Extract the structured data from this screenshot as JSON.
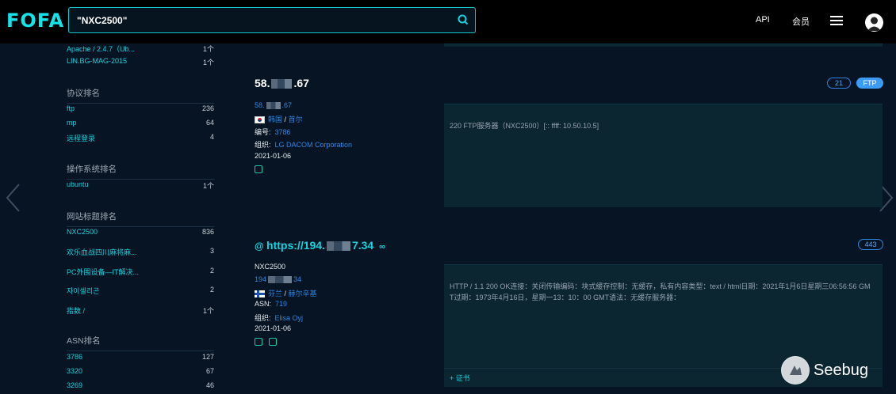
{
  "header": {
    "logo": "FOFA",
    "search_value": "\"NXC2500\"",
    "nav_api": "API",
    "nav_vip": "会员"
  },
  "sidebar": {
    "top_items": [
      {
        "label": "Apache / 2.4.7（Ub...",
        "count": "1个"
      },
      {
        "label": "LIN.BG-MAG-2015",
        "count": "1个"
      }
    ],
    "protocol": {
      "title": "协议排名",
      "items": [
        {
          "label": "ftp",
          "count": "236"
        },
        {
          "label": "mp",
          "count": "64"
        },
        {
          "label": "远程登录",
          "count": "4"
        }
      ]
    },
    "os": {
      "title": "操作系统排名",
      "items": [
        {
          "label": "ubuntu",
          "count": "1个"
        }
      ]
    },
    "site_title": {
      "title": "网站标题排名",
      "items": [
        {
          "label": "NXC2500",
          "count": "836"
        },
        {
          "label": "欢乐血战四川麻将麻...",
          "count": "3"
        },
        {
          "label": "PC外围设备—IT解决...",
          "count": "2"
        },
        {
          "label": "자이셀리곤",
          "count": "2"
        },
        {
          "label": "指数 /",
          "count": "1个"
        }
      ]
    },
    "asn": {
      "title": "ASN排名",
      "items": [
        {
          "label": "3786",
          "count": "127"
        },
        {
          "label": "3320",
          "count": "67"
        },
        {
          "label": "3269",
          "count": "46"
        }
      ]
    }
  },
  "results": [
    {
      "title_prefix": "58.",
      "title_suffix": ".67",
      "ip_prefix": "58.",
      "ip_suffix": ".67",
      "country": "韩国",
      "city": "首尔",
      "number_label": "编号:",
      "number_value": "3786",
      "org_label": "组织:",
      "org_value": "LG DACOM Corporation",
      "date": "2021-01-06",
      "port": "21",
      "protocol": "FTP",
      "banner": "220 FTP服务器（NXC2500）[:: ffff: 10.50.10.5]"
    },
    {
      "title_prefix": "https://194.",
      "title_suffix": "7.34",
      "site_title": "NXC2500",
      "ip_prefix": "194",
      "ip_suffix": "34",
      "country": "芬兰",
      "city": "赫尔辛基",
      "asn_label": "ASN:",
      "asn_value": "719",
      "org_label": "组织:",
      "org_value": "Elisa Oyj",
      "date": "2021-01-06",
      "port": "443",
      "banner_line1": "HTTP / 1.1 200 OK连接：关闭传输编码：块式缓存控制：无缓存，私有内容类型：text / html日期：2021年1月6日星期三06:56:56 GM",
      "banner_line2": "T过期：1973年4月16日，星期一13：10：00 GMT语法：无缓存服务器：",
      "cert_label": "+ 证书"
    }
  ],
  "watermark": "Seebug"
}
